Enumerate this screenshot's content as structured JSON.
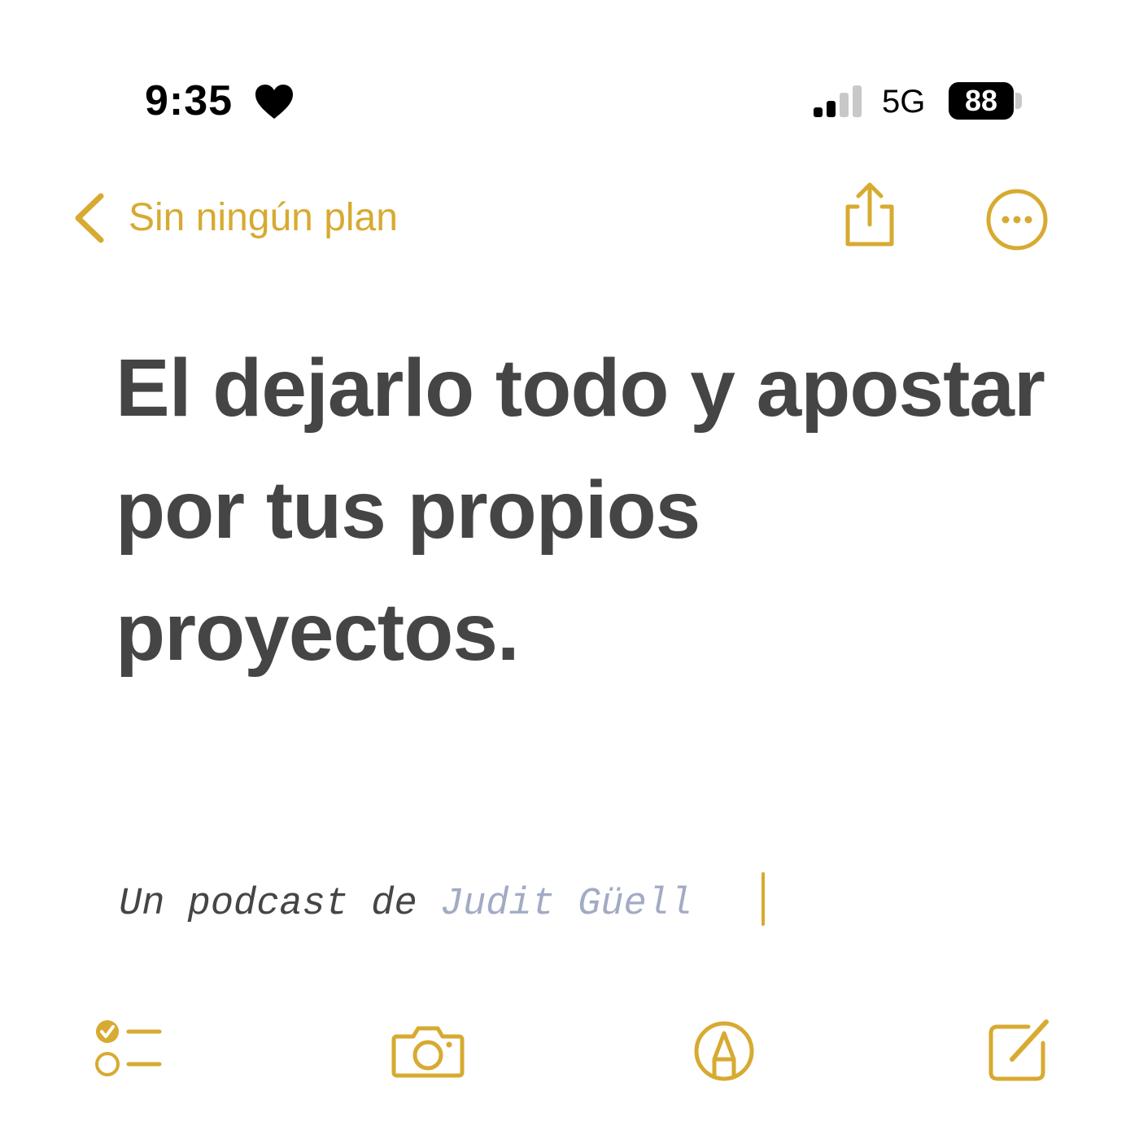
{
  "status_bar": {
    "time": "9:35",
    "heart_icon": "heart-icon",
    "signal_icon": "cellular-signal-icon",
    "signal_bars_active": 2,
    "signal_bars_total": 4,
    "network": "5G",
    "battery": "88"
  },
  "nav": {
    "back_label": "Sin ningún plan",
    "back_icon": "chevron-left-icon",
    "share_icon": "share-icon",
    "more_icon": "ellipsis-circle-icon"
  },
  "note": {
    "title": "El dejarlo todo y apostar por tus propios proyectos.",
    "subtitle_prefix": "Un podcast de ",
    "subtitle_highlight": "Judit Güell"
  },
  "toolbar": {
    "checklist_icon": "checklist-icon",
    "camera_icon": "camera-icon",
    "markup_icon": "markup-pen-icon",
    "compose_icon": "compose-icon"
  },
  "colors": {
    "accent": "#d7aa31",
    "text": "#454545",
    "highlight": "#a2abc4",
    "background": "#ffffff"
  }
}
